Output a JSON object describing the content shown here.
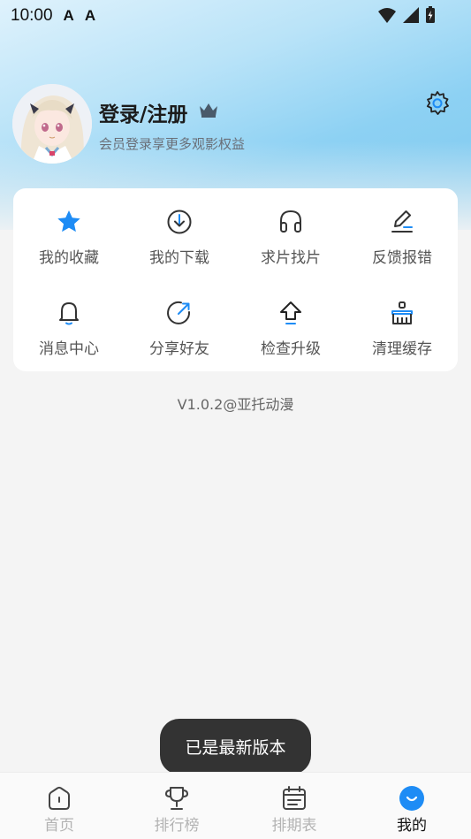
{
  "status_bar": {
    "time": "10:00",
    "notif1": "A",
    "notif2": "A"
  },
  "profile": {
    "title": "登录/注册",
    "subtitle": "会员登录享更多观影权益"
  },
  "menu": {
    "items": [
      {
        "label": "我的收藏",
        "icon": "star-icon"
      },
      {
        "label": "我的下载",
        "icon": "download-icon"
      },
      {
        "label": "求片找片",
        "icon": "headphones-icon"
      },
      {
        "label": "反馈报错",
        "icon": "edit-icon"
      },
      {
        "label": "消息中心",
        "icon": "bell-icon"
      },
      {
        "label": "分享好友",
        "icon": "share-icon"
      },
      {
        "label": "检查升级",
        "icon": "upgrade-icon"
      },
      {
        "label": "清理缓存",
        "icon": "broom-icon"
      }
    ]
  },
  "version": "V1.0.2@亚托动漫",
  "toast": "已是最新版本",
  "tabs": [
    {
      "label": "首页",
      "icon": "home-icon",
      "active": false
    },
    {
      "label": "排行榜",
      "icon": "trophy-icon",
      "active": false
    },
    {
      "label": "排期表",
      "icon": "calendar-icon",
      "active": false
    },
    {
      "label": "我的",
      "icon": "profile-icon",
      "active": true
    }
  ],
  "colors": {
    "accent": "#1e8cf5",
    "toast_bg": "#333333",
    "header_blue": "#7fc9f0"
  }
}
